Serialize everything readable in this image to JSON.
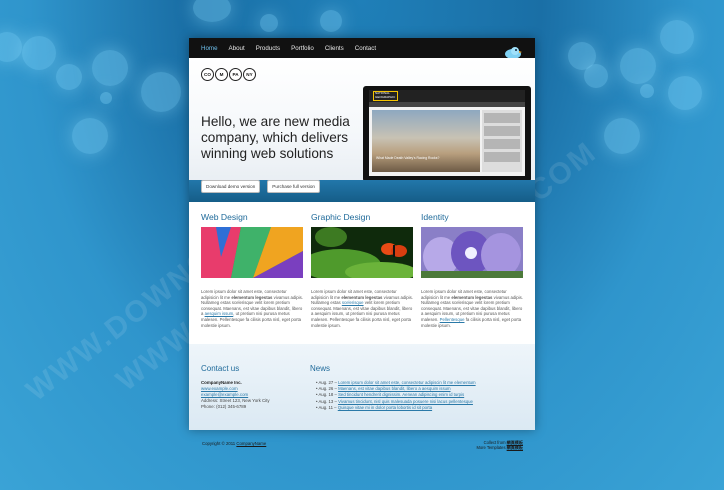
{
  "nav": {
    "items": [
      "Home",
      "About",
      "Products",
      "Portfolio",
      "Clients",
      "Contact"
    ],
    "active": "Home"
  },
  "logo": {
    "letters": [
      "CO",
      "M",
      "PA",
      "NY"
    ]
  },
  "hero": {
    "headline": "Hello, we are new media company, which delivers winning web solutions",
    "buttons": {
      "download": "Download demo version",
      "purchase": "Purchase full version"
    }
  },
  "laptop": {
    "brand_line1": "NATIONAL",
    "brand_line2": "GEOGRAPHIC",
    "caption": "What Made Death Valley's Racing Rocks?"
  },
  "services": [
    {
      "title": "Web Design",
      "text_before": "Lorem ipsum dolor sit amet este, consectetur adipisicin lit me ",
      "bold": "elementum legestas",
      "text_after": " vivamus adipis. Nullameg estas scelerisque velit lorem pretium consequat. Maenans, est vitae dapibus blandit, libero a ",
      "link": "aesquim issum",
      "text_end": ", ut pretium nisi purusa metus malesen. Pellentesque fa cilisis porta nisl, eget porta molestie ipsum."
    },
    {
      "title": "Graphic Design",
      "text_before": "Lorem ipsum dolor sit amet este, consectetur adipisicin lit me ",
      "bold": "elementum legestas",
      "text_after": " vivamus adipis. Nullameg estas ",
      "link": "scelerisque",
      "text_end": " velit lorem pretium consequat. Maenans, est vitae dapibus blandit, libero a aesquim issum, ut pretium nisi purusa metus malesen. Pellentesque fa cilisis porta nisl, eget porta molestie ipsum."
    },
    {
      "title": "Identity",
      "text_before": "Lorem ipsum dolor sit amet este, consectetur adipisicin lit me ",
      "bold": "elementum legestas",
      "text_after": " vivamus adipis. Nullameg estas scelerisque velit lorem pretium consequat. Maenans, est vitae dapibus blandit, libero a aesquim issum, ut pretium nisi purusa metus malesen. ",
      "link": "Pellentesque",
      "text_end": " fa cilisis porta nisl, eget porta molestie ipsum."
    }
  ],
  "contact": {
    "heading": "Contact us",
    "company": "CompanyName Inc.",
    "website": "www.example.com",
    "email": "example@example.com",
    "address": "Address: Street 123, New York City",
    "phone": "Phone: (012) 345-6789"
  },
  "news": {
    "heading": "News",
    "items": [
      {
        "date": "Aug. 27 – ",
        "text": "Lorem ipsum dolor sit amet este, consectetur adipiscin lit me elementum"
      },
      {
        "date": "Aug. 26 – ",
        "text": "Maenans, est vitae dapibus blandit, libero a aesquim issum"
      },
      {
        "date": "Aug. 18 – ",
        "text": "Sed tincidunt hendrerit dignissim. Aenean adipiscing enim id turpis"
      },
      {
        "date": "Aug. 13 – ",
        "text": "Vivamus tincidunt, nisl quis malesuada posuere nisi lacus pellentesque"
      },
      {
        "date": "Aug. 11 – ",
        "text": "Quisque vitae mi in dolor porta lobortis id sit porta"
      }
    ]
  },
  "footer": {
    "copyright": "Copyright © 2011 ",
    "company_link": "CompanyName",
    "credit1_label": "Collect from ",
    "credit1_link": "網頁模板",
    "credit2_label": "More Templates ",
    "credit2_link": "網頁模板"
  },
  "watermark": "WWW.DOWNCODE.COM",
  "colors": {
    "accent": "#1f6a9a",
    "nav_active": "#6fc1ee",
    "hero_band": "#1b6b9c"
  }
}
